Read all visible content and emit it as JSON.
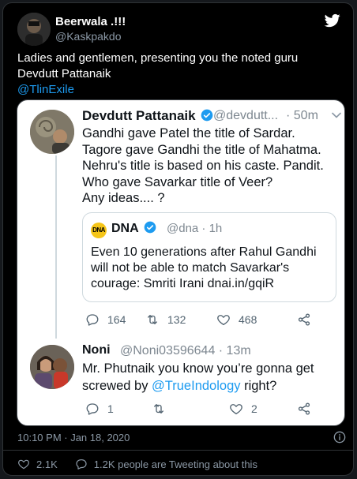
{
  "outer_tweet": {
    "display_name": "Beerwala .!!!",
    "handle": "@Kaskpakdo",
    "text_line1": "Ladies and gentlemen, presenting you the noted guru",
    "text_line2": "Devdutt Pattanaik",
    "mention": "@TlinExile"
  },
  "quoted_thread": {
    "tweet_a": {
      "display_name": "Devdutt Pattanaik",
      "handle": "@devdutt...",
      "time": "· 50m",
      "lines": [
        "Gandhi gave Patel the title of Sardar.",
        "Tagore gave Gandhi the title of Mahatma.",
        "Nehru's title is based on his caste. Pandit.",
        "Who gave Savarkar title of Veer?",
        "Any ideas.... ?"
      ],
      "inner_quote": {
        "logo": "DNA",
        "name": "DNA",
        "handle": "@dna · 1h",
        "lines": [
          "Even 10 generations after Rahul Gandhi",
          "will not be able to match Savarkar's",
          "courage: Smriti Irani   dnai.in/gqiR"
        ]
      },
      "actions": {
        "replies": "164",
        "retweets": "132",
        "likes": "468"
      }
    },
    "tweet_b": {
      "display_name": "Noni",
      "handle": "@Noni03596644 · 13m",
      "text_line1": "Mr. Phutnaik you know you’re gonna get",
      "text_line2_prefix": "screwed by ",
      "mention": "@TrueIndology",
      "text_line2_suffix": " right?",
      "actions": {
        "replies": "1",
        "retweets": "",
        "likes": "2"
      }
    }
  },
  "footer": {
    "timestamp": "10:10 PM · Jan 18, 2020",
    "likes": "2.1K",
    "conversation": "1.2K people are Tweeting about this"
  },
  "colors": {
    "background": "#000000",
    "link": "#1d9bf0",
    "verified": "#1d9bf0",
    "muted": "#8b98a5",
    "dna_logo": "#f5c518"
  },
  "icons": {
    "brand": "twitter-bird-icon",
    "reply": "reply-icon",
    "retweet": "retweet-icon",
    "like": "heart-icon",
    "share": "share-icon",
    "info": "info-icon",
    "chevron": "chevron-down-icon",
    "verified": "verified-badge-icon"
  }
}
